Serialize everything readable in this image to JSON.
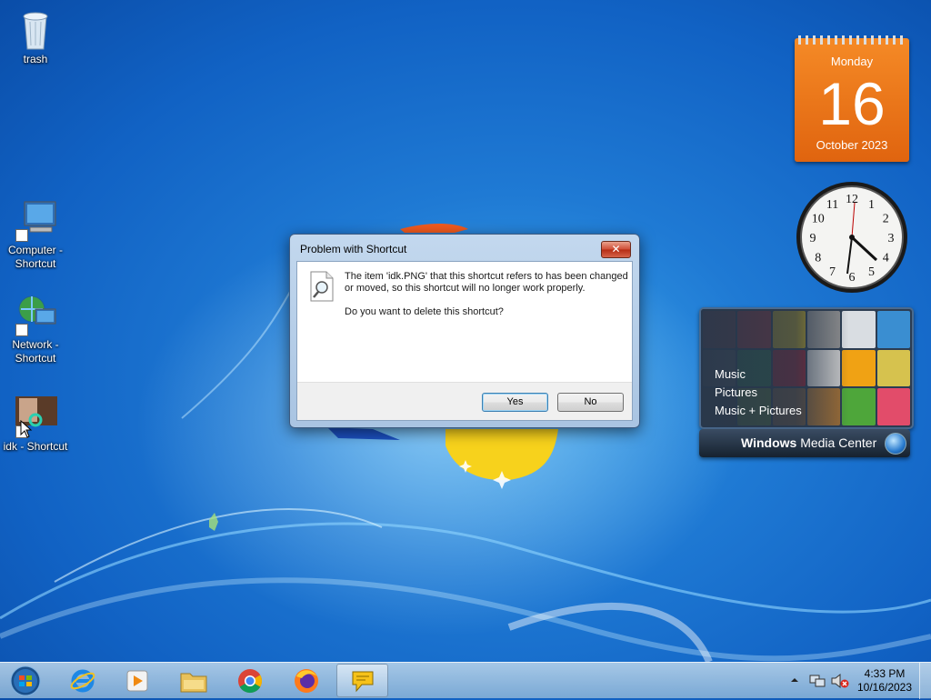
{
  "desktop": {
    "icons": [
      {
        "label": "trash"
      },
      {
        "label": "Computer - Shortcut"
      },
      {
        "label": "Network - Shortcut"
      },
      {
        "label": "idk - Shortcut"
      }
    ]
  },
  "gadgets": {
    "calendar": {
      "weekday": "Monday",
      "day": "16",
      "month_year": "October 2023"
    },
    "clock": {
      "numerals": [
        "12",
        "1",
        "2",
        "3",
        "4",
        "5",
        "6",
        "7",
        "8",
        "9",
        "10",
        "11"
      ]
    },
    "media_center": {
      "menu": [
        "Music",
        "Pictures",
        "Music + Pictures"
      ],
      "brand_bold": "Windows",
      "brand_rest": " Media Center"
    }
  },
  "dialog": {
    "title": "Problem with Shortcut",
    "close_label": "✕",
    "message": "The item 'idk.PNG' that this shortcut refers to has been changed or moved, so this shortcut will no longer work properly.",
    "question": "Do you want to delete this shortcut?",
    "yes_label": "Yes",
    "no_label": "No"
  },
  "taskbar": {
    "apps": [
      {
        "icon": "internet-explorer-icon"
      },
      {
        "icon": "media-player-icon"
      },
      {
        "icon": "file-explorer-icon"
      },
      {
        "icon": "chrome-icon"
      },
      {
        "icon": "firefox-icon"
      },
      {
        "icon": "chat-bubble-icon"
      }
    ],
    "time": "4:33 PM",
    "date": "10/16/2023"
  },
  "colors": {
    "calendar_orange": "#e8711a",
    "dialog_close_red": "#c8412a",
    "desktop_blue": "#1a6fcc"
  }
}
